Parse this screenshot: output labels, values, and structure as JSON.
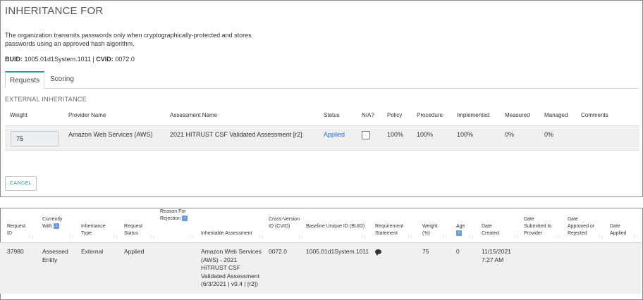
{
  "header": {
    "title": "INHERITANCE FOR",
    "description": "The organization transmits passwords only when cryptographically-protected and stores passwords using an approved hash algorithm.",
    "buid_label": "BUID:",
    "buid_value": "1005.01d1System.1011",
    "separator": "|",
    "cvid_label": "CVID:",
    "cvid_value": "0072.0"
  },
  "tabs": [
    {
      "label": "Requests",
      "active": true
    },
    {
      "label": "Scoring",
      "active": false
    }
  ],
  "external": {
    "section_label": "EXTERNAL INHERITANCE",
    "columns": [
      "Weight",
      "Provider Name",
      "Assessment Name",
      "Status",
      "N/A?",
      "Policy",
      "Procedure",
      "Implemented",
      "Measured",
      "Managed",
      "Comments"
    ],
    "row": {
      "weight": "75",
      "provider": "Amazon Web Services (AWS)",
      "assessment": "2021 HITRUST CSF Validated Assessment [r2]",
      "status": "Applied",
      "na_checked": false,
      "policy": "100%",
      "procedure": "100%",
      "implemented": "100%",
      "measured": "0%",
      "managed": "0%",
      "comments": ""
    },
    "cancel_label": "CANCEL"
  },
  "requests_table": {
    "columns": {
      "request_id": "Request ID",
      "currently_with": "Currently With",
      "inheritance_type": "Inheritance Type",
      "request_status": "Request Status",
      "reason_for_rejection": "Reason For Rejection",
      "inheritable_assessment": "Inheritable Assessment",
      "cvid": "Cross-Version ID (CVID)",
      "buid": "Baseline Unique ID (BUID)",
      "requirement_statement": "Requirement Statement",
      "weight": "Weight (%)",
      "age": "Age",
      "date_created": "Date Created",
      "date_submitted": "Date Submitted to Provider",
      "date_approved": "Date Approved or Rejected",
      "date_applied": "Date Applied"
    },
    "info_glyph": "i",
    "sort_glyph": "↑↓",
    "rows": [
      {
        "request_id": "37980",
        "currently_with": "Assessed Entity",
        "inheritance_type": "External",
        "request_status": "Applied",
        "reason_for_rejection": "",
        "inheritable_assessment": "Amazon Web Services (AWS) - 2021 HITRUST CSF Validated Assessment (6/3/2021 | v9.4 | [r2])",
        "cvid": "0072.0",
        "buid": "1005.01d1System.1011",
        "requirement_statement_icon": "comment-icon",
        "weight": "75",
        "age": "0",
        "date_created": "11/15/2021 7:27 AM",
        "date_submitted": "",
        "date_approved": "",
        "date_applied": ""
      }
    ]
  },
  "colors": {
    "accent": "#2aa08a",
    "link": "#1f6fd0",
    "info_badge": "#6b9bd8",
    "row_bg": "#f0f0f0"
  }
}
